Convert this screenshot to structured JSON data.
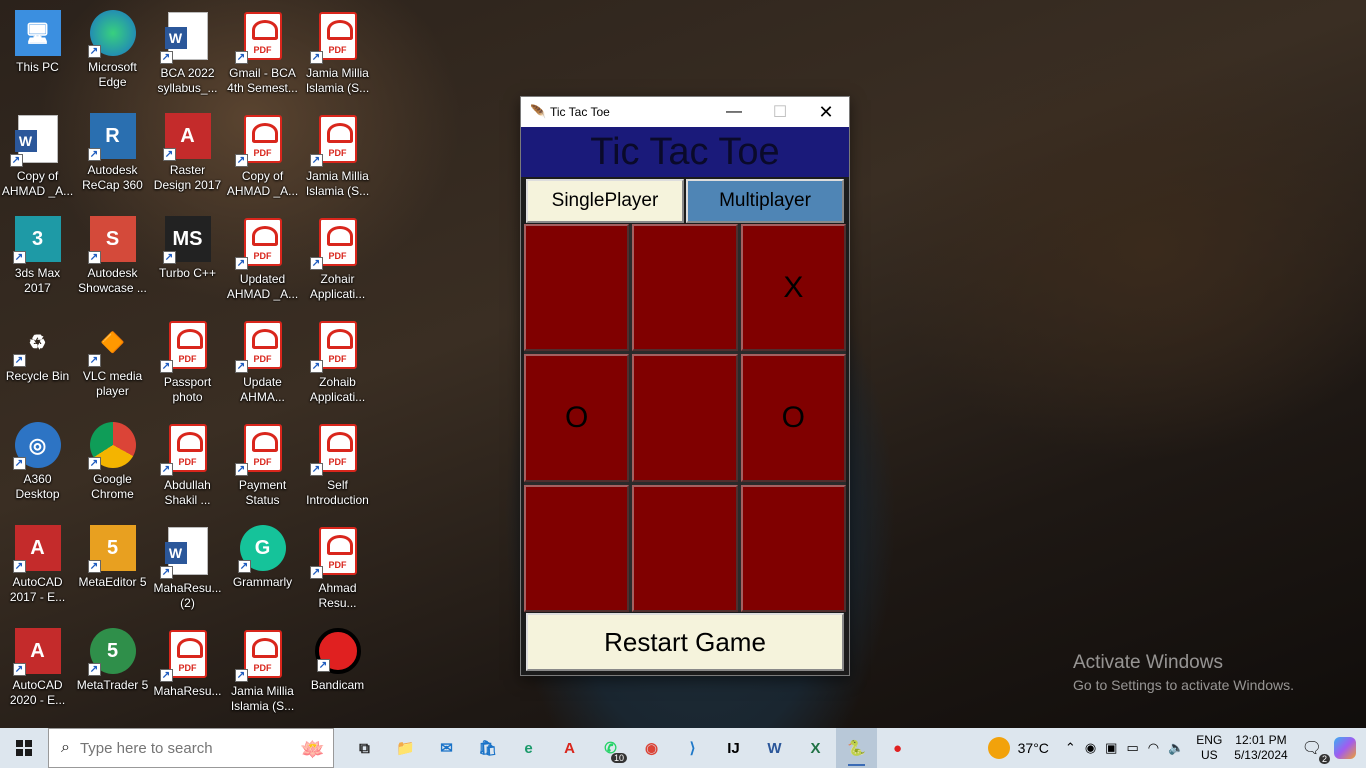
{
  "desktop_icons": [
    {
      "label": "This PC",
      "icon": "computer-icon",
      "col": 0,
      "row": 0
    },
    {
      "label": "Microsoft Edge",
      "icon": "edge-icon",
      "col": 1,
      "row": 0
    },
    {
      "label": "BCA 2022 syllabus_...",
      "icon": "word-doc-icon",
      "col": 2,
      "row": 0
    },
    {
      "label": "Gmail - BCA 4th Semest...",
      "icon": "pdf-icon",
      "col": 3,
      "row": 0
    },
    {
      "label": "Jamia Millia Islamia (S...",
      "icon": "pdf-icon",
      "col": 4,
      "row": 0
    },
    {
      "label": "Copy of AHMAD _A...",
      "icon": "word-doc-icon",
      "col": 0,
      "row": 1
    },
    {
      "label": "Autodesk ReCap 360",
      "icon": "recap-icon",
      "col": 1,
      "row": 1
    },
    {
      "label": "Raster Design 2017 on Au...",
      "icon": "raster-design-icon",
      "col": 2,
      "row": 1
    },
    {
      "label": "Copy of AHMAD _A...",
      "icon": "pdf-icon",
      "col": 3,
      "row": 1
    },
    {
      "label": "Jamia Millia Islamia (S...",
      "icon": "pdf-icon",
      "col": 4,
      "row": 1
    },
    {
      "label": "3ds Max 2017",
      "icon": "3ds-max-icon",
      "col": 0,
      "row": 2
    },
    {
      "label": "Autodesk Showcase ...",
      "icon": "showcase-icon",
      "col": 1,
      "row": 2
    },
    {
      "label": "Turbo C++",
      "icon": "turbo-cpp-icon",
      "col": 2,
      "row": 2
    },
    {
      "label": "Updated AHMAD _A...",
      "icon": "pdf-icon",
      "col": 3,
      "row": 2
    },
    {
      "label": "Zohair Applicati...",
      "icon": "pdf-icon",
      "col": 4,
      "row": 2
    },
    {
      "label": "Recycle Bin",
      "icon": "recycle-bin-icon",
      "col": 0,
      "row": 3
    },
    {
      "label": "VLC media player",
      "icon": "vlc-icon",
      "col": 1,
      "row": 3
    },
    {
      "label": "Passport photo",
      "icon": "pdf-icon",
      "col": 2,
      "row": 3
    },
    {
      "label": "Update AHMA...",
      "icon": "pdf-icon",
      "col": 3,
      "row": 3
    },
    {
      "label": "Zohaib Applicati...",
      "icon": "pdf-icon",
      "col": 4,
      "row": 3
    },
    {
      "label": "A360 Desktop",
      "icon": "a360-icon",
      "col": 0,
      "row": 4
    },
    {
      "label": "Google Chrome",
      "icon": "chrome-icon",
      "col": 1,
      "row": 4
    },
    {
      "label": "Abdullah Shakil ...",
      "icon": "pdf-icon",
      "col": 2,
      "row": 4
    },
    {
      "label": "Payment Status",
      "icon": "pdf-icon",
      "col": 3,
      "row": 4
    },
    {
      "label": "Self Introduction",
      "icon": "pdf-icon",
      "col": 4,
      "row": 4
    },
    {
      "label": "AutoCAD 2017 - E...",
      "icon": "autocad-icon",
      "col": 0,
      "row": 5
    },
    {
      "label": "MetaEditor 5",
      "icon": "metaeditor-icon",
      "col": 1,
      "row": 5
    },
    {
      "label": "MahaResu... (2)",
      "icon": "word-doc-icon",
      "col": 2,
      "row": 5
    },
    {
      "label": "Grammarly",
      "icon": "grammarly-icon",
      "col": 3,
      "row": 5
    },
    {
      "label": "Ahmad Resu...",
      "icon": "pdf-icon",
      "col": 4,
      "row": 5
    },
    {
      "label": "AutoCAD 2020 - E...",
      "icon": "autocad-icon",
      "col": 0,
      "row": 6
    },
    {
      "label": "MetaTrader 5",
      "icon": "metatrader-icon",
      "col": 1,
      "row": 6
    },
    {
      "label": "MahaResu...",
      "icon": "pdf-icon",
      "col": 2,
      "row": 6
    },
    {
      "label": "Jamia Millia Islamia (S...",
      "icon": "pdf-icon",
      "col": 3,
      "row": 6
    },
    {
      "label": "Bandicam",
      "icon": "bandicam-icon",
      "col": 4,
      "row": 6
    }
  ],
  "window": {
    "title": "Tic Tac Toe",
    "controls": {
      "minimize": "—",
      "maximize": "☐",
      "close": "✕"
    }
  },
  "game": {
    "heading": "Tic Tac Toe",
    "heading_bg": "#1a1a7a",
    "modes": {
      "single": "SinglePlayer",
      "multi": "Multiplayer"
    },
    "board": [
      "",
      "",
      "X",
      "O",
      "",
      "O",
      "",
      "",
      ""
    ],
    "cell_color": "#800000",
    "restart": "Restart Game"
  },
  "watermark": {
    "title": "Activate Windows",
    "subtitle": "Go to Settings to activate Windows."
  },
  "taskbar": {
    "search_placeholder": "Type here to search",
    "apps": [
      {
        "name": "task-view",
        "glyph": "⧉"
      },
      {
        "name": "file-explorer",
        "glyph": "📁"
      },
      {
        "name": "mail",
        "glyph": "✉"
      },
      {
        "name": "microsoft-store",
        "glyph": "🛍"
      },
      {
        "name": "edge",
        "glyph": "e"
      },
      {
        "name": "acrobat",
        "glyph": "A"
      },
      {
        "name": "whatsapp",
        "glyph": "✆",
        "badge": "10"
      },
      {
        "name": "chrome",
        "glyph": "◉"
      },
      {
        "name": "vscode",
        "glyph": "⟩"
      },
      {
        "name": "intellij",
        "glyph": "IJ"
      },
      {
        "name": "word",
        "glyph": "W"
      },
      {
        "name": "excel",
        "glyph": "X"
      },
      {
        "name": "python",
        "glyph": "🐍",
        "active": true
      },
      {
        "name": "bandicam",
        "glyph": "●"
      }
    ],
    "weather": {
      "temp": "37°C",
      "badge": "1"
    },
    "language": {
      "line1": "ENG",
      "line2": "US"
    },
    "clock": {
      "time": "12:01 PM",
      "date": "5/13/2024"
    },
    "notifications": "2"
  }
}
